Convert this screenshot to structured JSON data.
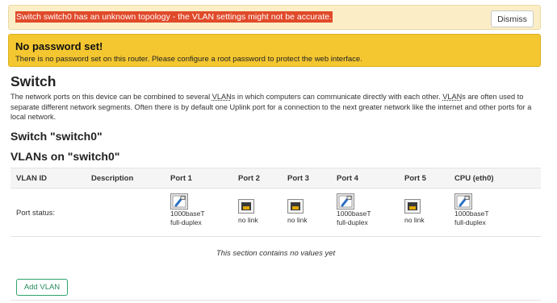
{
  "warning": {
    "message": "Switch switch0 has an unknown topology - the VLAN settings might not be accurate.",
    "dismiss_label": "Dismiss"
  },
  "no_password": {
    "title": "No password set!",
    "text": "There is no password set on this router. Please configure a root password to protect the web interface."
  },
  "page": {
    "title": "Switch",
    "description_parts": [
      "The network ports on this device can be combined to several ",
      "VLAN",
      "s in which computers can communicate directly with each other. ",
      "VLAN",
      "s are often used to separate different network segments. Often there is by default one Uplink port for a connection to the next greater network like the internet and other ports for a local network."
    ],
    "switch_heading": "Switch \"switch0\"",
    "vlans_heading": "VLANs on \"switch0\""
  },
  "table": {
    "headers": [
      "VLAN ID",
      "Description",
      "Port 1",
      "Port 2",
      "Port 3",
      "Port 4",
      "Port 5",
      "CPU (eth0)"
    ],
    "status_label": "Port status:",
    "ports": [
      {
        "name": "Port 1",
        "icon": "ethernet-connected-icon",
        "line1": "1000baseT",
        "line2": "full-duplex"
      },
      {
        "name": "Port 2",
        "icon": "ethernet-disconnected-icon",
        "line1": "no link",
        "line2": ""
      },
      {
        "name": "Port 3",
        "icon": "ethernet-disconnected-icon",
        "line1": "no link",
        "line2": ""
      },
      {
        "name": "Port 4",
        "icon": "ethernet-connected-icon",
        "line1": "1000baseT",
        "line2": "full-duplex"
      },
      {
        "name": "Port 5",
        "icon": "ethernet-disconnected-icon",
        "line1": "no link",
        "line2": ""
      },
      {
        "name": "CPU (eth0)",
        "icon": "ethernet-connected-icon",
        "line1": "1000baseT",
        "line2": "full-duplex"
      }
    ],
    "empty_message": "This section contains no values yet"
  },
  "actions": {
    "add_vlan_label": "Add VLAN"
  },
  "colors": {
    "warning_bg": "#fbeec7",
    "warning_highlight": "#e04a2a",
    "alert_yellow": "#f4c731",
    "accent_green": "#2fa36b"
  }
}
